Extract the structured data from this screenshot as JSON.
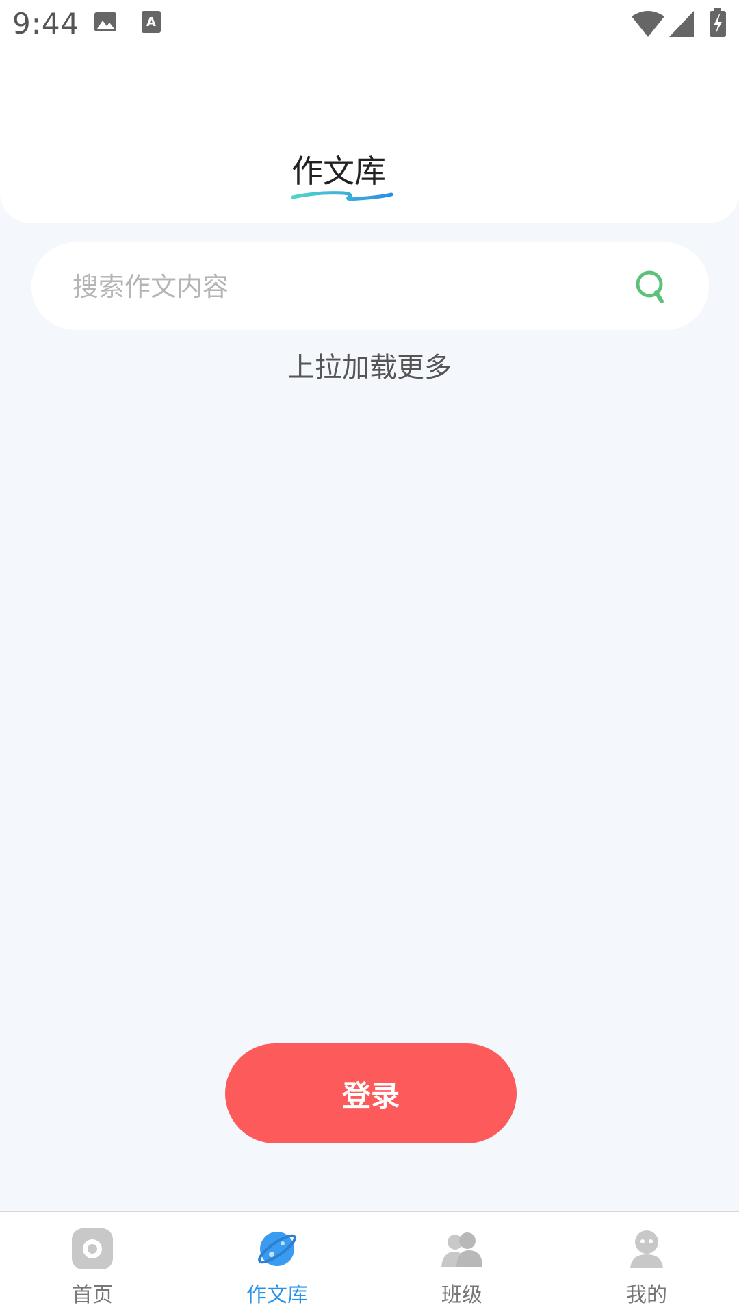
{
  "status_bar": {
    "time": "9:44"
  },
  "header": {
    "title": "作文库"
  },
  "search": {
    "placeholder": "搜索作文内容",
    "value": ""
  },
  "list": {
    "load_more": "上拉加载更多"
  },
  "login": {
    "label": "登录"
  },
  "bottom_nav": {
    "items": [
      {
        "label": "首页",
        "icon": "home-icon",
        "active": false
      },
      {
        "label": "作文库",
        "icon": "planet-icon",
        "active": true
      },
      {
        "label": "班级",
        "icon": "group-icon",
        "active": false
      },
      {
        "label": "我的",
        "icon": "profile-icon",
        "active": false
      }
    ]
  },
  "colors": {
    "accent": "#2a93e8",
    "login_button": "#fd5a5c",
    "search_icon": "#5cc27a",
    "page_background": "#f4f8fc"
  }
}
